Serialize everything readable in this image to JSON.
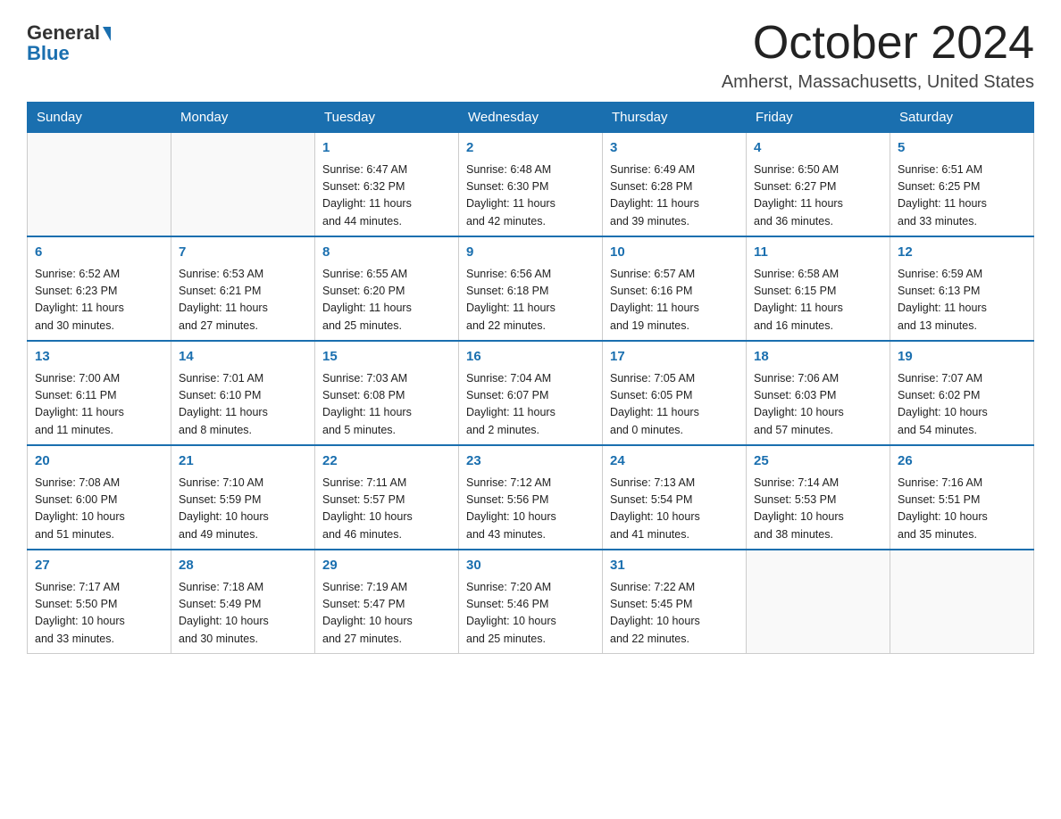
{
  "header": {
    "logo": {
      "general": "General",
      "blue": "Blue"
    },
    "month_year": "October 2024",
    "location": "Amherst, Massachusetts, United States"
  },
  "weekdays": [
    "Sunday",
    "Monday",
    "Tuesday",
    "Wednesday",
    "Thursday",
    "Friday",
    "Saturday"
  ],
  "weeks": [
    [
      {
        "day": "",
        "info": ""
      },
      {
        "day": "",
        "info": ""
      },
      {
        "day": "1",
        "info": "Sunrise: 6:47 AM\nSunset: 6:32 PM\nDaylight: 11 hours\nand 44 minutes."
      },
      {
        "day": "2",
        "info": "Sunrise: 6:48 AM\nSunset: 6:30 PM\nDaylight: 11 hours\nand 42 minutes."
      },
      {
        "day": "3",
        "info": "Sunrise: 6:49 AM\nSunset: 6:28 PM\nDaylight: 11 hours\nand 39 minutes."
      },
      {
        "day": "4",
        "info": "Sunrise: 6:50 AM\nSunset: 6:27 PM\nDaylight: 11 hours\nand 36 minutes."
      },
      {
        "day": "5",
        "info": "Sunrise: 6:51 AM\nSunset: 6:25 PM\nDaylight: 11 hours\nand 33 minutes."
      }
    ],
    [
      {
        "day": "6",
        "info": "Sunrise: 6:52 AM\nSunset: 6:23 PM\nDaylight: 11 hours\nand 30 minutes."
      },
      {
        "day": "7",
        "info": "Sunrise: 6:53 AM\nSunset: 6:21 PM\nDaylight: 11 hours\nand 27 minutes."
      },
      {
        "day": "8",
        "info": "Sunrise: 6:55 AM\nSunset: 6:20 PM\nDaylight: 11 hours\nand 25 minutes."
      },
      {
        "day": "9",
        "info": "Sunrise: 6:56 AM\nSunset: 6:18 PM\nDaylight: 11 hours\nand 22 minutes."
      },
      {
        "day": "10",
        "info": "Sunrise: 6:57 AM\nSunset: 6:16 PM\nDaylight: 11 hours\nand 19 minutes."
      },
      {
        "day": "11",
        "info": "Sunrise: 6:58 AM\nSunset: 6:15 PM\nDaylight: 11 hours\nand 16 minutes."
      },
      {
        "day": "12",
        "info": "Sunrise: 6:59 AM\nSunset: 6:13 PM\nDaylight: 11 hours\nand 13 minutes."
      }
    ],
    [
      {
        "day": "13",
        "info": "Sunrise: 7:00 AM\nSunset: 6:11 PM\nDaylight: 11 hours\nand 11 minutes."
      },
      {
        "day": "14",
        "info": "Sunrise: 7:01 AM\nSunset: 6:10 PM\nDaylight: 11 hours\nand 8 minutes."
      },
      {
        "day": "15",
        "info": "Sunrise: 7:03 AM\nSunset: 6:08 PM\nDaylight: 11 hours\nand 5 minutes."
      },
      {
        "day": "16",
        "info": "Sunrise: 7:04 AM\nSunset: 6:07 PM\nDaylight: 11 hours\nand 2 minutes."
      },
      {
        "day": "17",
        "info": "Sunrise: 7:05 AM\nSunset: 6:05 PM\nDaylight: 11 hours\nand 0 minutes."
      },
      {
        "day": "18",
        "info": "Sunrise: 7:06 AM\nSunset: 6:03 PM\nDaylight: 10 hours\nand 57 minutes."
      },
      {
        "day": "19",
        "info": "Sunrise: 7:07 AM\nSunset: 6:02 PM\nDaylight: 10 hours\nand 54 minutes."
      }
    ],
    [
      {
        "day": "20",
        "info": "Sunrise: 7:08 AM\nSunset: 6:00 PM\nDaylight: 10 hours\nand 51 minutes."
      },
      {
        "day": "21",
        "info": "Sunrise: 7:10 AM\nSunset: 5:59 PM\nDaylight: 10 hours\nand 49 minutes."
      },
      {
        "day": "22",
        "info": "Sunrise: 7:11 AM\nSunset: 5:57 PM\nDaylight: 10 hours\nand 46 minutes."
      },
      {
        "day": "23",
        "info": "Sunrise: 7:12 AM\nSunset: 5:56 PM\nDaylight: 10 hours\nand 43 minutes."
      },
      {
        "day": "24",
        "info": "Sunrise: 7:13 AM\nSunset: 5:54 PM\nDaylight: 10 hours\nand 41 minutes."
      },
      {
        "day": "25",
        "info": "Sunrise: 7:14 AM\nSunset: 5:53 PM\nDaylight: 10 hours\nand 38 minutes."
      },
      {
        "day": "26",
        "info": "Sunrise: 7:16 AM\nSunset: 5:51 PM\nDaylight: 10 hours\nand 35 minutes."
      }
    ],
    [
      {
        "day": "27",
        "info": "Sunrise: 7:17 AM\nSunset: 5:50 PM\nDaylight: 10 hours\nand 33 minutes."
      },
      {
        "day": "28",
        "info": "Sunrise: 7:18 AM\nSunset: 5:49 PM\nDaylight: 10 hours\nand 30 minutes."
      },
      {
        "day": "29",
        "info": "Sunrise: 7:19 AM\nSunset: 5:47 PM\nDaylight: 10 hours\nand 27 minutes."
      },
      {
        "day": "30",
        "info": "Sunrise: 7:20 AM\nSunset: 5:46 PM\nDaylight: 10 hours\nand 25 minutes."
      },
      {
        "day": "31",
        "info": "Sunrise: 7:22 AM\nSunset: 5:45 PM\nDaylight: 10 hours\nand 22 minutes."
      },
      {
        "day": "",
        "info": ""
      },
      {
        "day": "",
        "info": ""
      }
    ]
  ]
}
